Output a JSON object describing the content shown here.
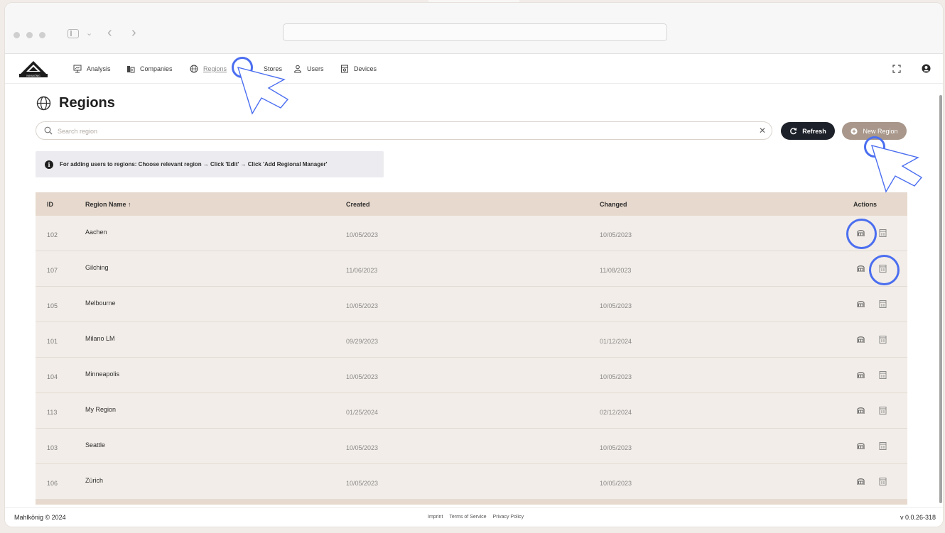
{
  "nav": {
    "items": [
      {
        "label": "Analysis",
        "icon": "monitor-chart-icon"
      },
      {
        "label": "Companies",
        "icon": "building-icon"
      },
      {
        "label": "Regions",
        "icon": "globe-icon"
      },
      {
        "label": "Stores",
        "icon": "store-icon"
      },
      {
        "label": "Users",
        "icon": "users-icon"
      },
      {
        "label": "Devices",
        "icon": "device-icon"
      }
    ],
    "active": "Regions"
  },
  "page": {
    "title": "Regions",
    "search_placeholder": "Search region",
    "refresh_label": "Refresh",
    "new_label": "New Region",
    "info_text": "For adding users to regions: Choose relevant region → Click 'Edit' → Click 'Add Regional Manager'"
  },
  "table": {
    "headers": {
      "id": "ID",
      "name": "Region Name ↑",
      "created": "Created",
      "changed": "Changed",
      "actions": "Actions"
    },
    "rows": [
      {
        "id": "102",
        "name": "Aachen",
        "created": "10/05/2023",
        "changed": "10/05/2023"
      },
      {
        "id": "107",
        "name": "Gilching",
        "created": "11/06/2023",
        "changed": "11/08/2023"
      },
      {
        "id": "105",
        "name": "Melbourne",
        "created": "10/05/2023",
        "changed": "10/05/2023"
      },
      {
        "id": "101",
        "name": "Milano LM",
        "created": "09/29/2023",
        "changed": "01/12/2024"
      },
      {
        "id": "104",
        "name": "Minneapolis",
        "created": "10/05/2023",
        "changed": "10/05/2023"
      },
      {
        "id": "113",
        "name": "My Region",
        "created": "01/25/2024",
        "changed": "02/12/2024"
      },
      {
        "id": "103",
        "name": "Seattle",
        "created": "10/05/2023",
        "changed": "10/05/2023"
      },
      {
        "id": "106",
        "name": "Zürich",
        "created": "10/05/2023",
        "changed": "10/05/2023"
      }
    ]
  },
  "footer": {
    "copyright": "Mahlkönig © 2024",
    "links": [
      "Imprint",
      "Terms of Service",
      "Privacy Policy"
    ],
    "version": "v 0.0.26-318"
  },
  "colors": {
    "header_bg": "#e7d9cd",
    "row_bg": "#f2ede8",
    "refresh_btn": "#1d2129",
    "new_btn": "#a8978a",
    "highlight": "#4b6ef0"
  }
}
